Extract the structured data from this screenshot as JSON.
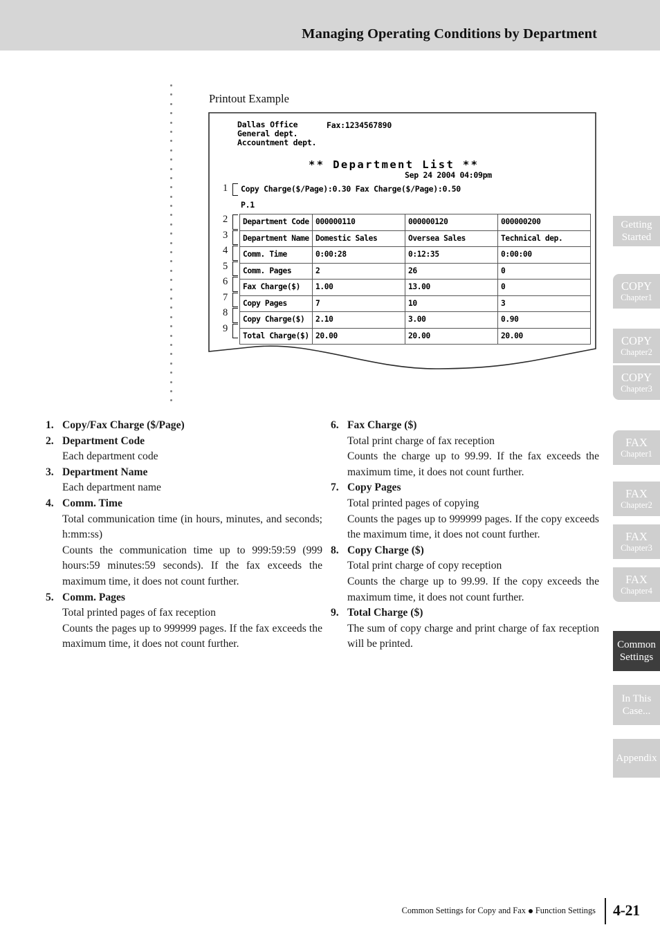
{
  "header": {
    "title": "Managing Operating Conditions by Department"
  },
  "figure": {
    "caption": "Printout Example",
    "printout": {
      "company": "Dallas Office",
      "dept1": "General dept.",
      "dept2": "Accountment dept.",
      "fax": "Fax:1234567890",
      "title": "** Department List **",
      "date": "Sep 24 2004 04:09pm",
      "charge_line": "Copy Charge($/Page):0.30  Fax Charge($/Page):0.50",
      "page_no": "P.1",
      "rows": [
        {
          "marker": "2",
          "label": "Department Code",
          "values": [
            "000000110",
            "000000120",
            "000000200"
          ]
        },
        {
          "marker": "3",
          "label": "Department Name",
          "values": [
            "Domestic Sales",
            "Oversea Sales",
            "Technical dep."
          ]
        },
        {
          "marker": "4",
          "label": "Comm. Time",
          "values": [
            "0:00:28",
            "0:12:35",
            "0:00:00"
          ]
        },
        {
          "marker": "5",
          "label": "Comm. Pages",
          "values": [
            "2",
            "26",
            "0"
          ]
        },
        {
          "marker": "6",
          "label": "Fax Charge($)",
          "values": [
            "1.00",
            "13.00",
            "0"
          ]
        },
        {
          "marker": "7",
          "label": "Copy Pages",
          "values": [
            "7",
            "10",
            "3"
          ]
        },
        {
          "marker": "8",
          "label": "Copy Charge($)",
          "values": [
            "2.10",
            "3.00",
            "0.90"
          ]
        },
        {
          "marker": "9",
          "label": "Total Charge($)",
          "values": [
            "20.00",
            "20.00",
            "20.00"
          ]
        }
      ],
      "charge_marker": "1"
    }
  },
  "legend": {
    "left": [
      {
        "num": "1.",
        "title": "Copy/Fax Charge ($/Page)",
        "lines": []
      },
      {
        "num": "2.",
        "title": "Department Code",
        "lines": [
          "Each department code"
        ]
      },
      {
        "num": "3.",
        "title": "Department Name",
        "lines": [
          "Each department name"
        ]
      },
      {
        "num": "4.",
        "title": "Comm. Time",
        "lines": [
          "Total communication time (in hours, minutes, and seconds; h:mm:ss)",
          "Counts the communication time up to 999:59:59 (999 hours:59 minutes:59 seconds). If the fax exceeds the maximum time, it does not count further."
        ]
      },
      {
        "num": "5.",
        "title": "Comm. Pages",
        "lines": [
          "Total printed pages of fax reception",
          "Counts the pages up to 999999 pages. If the fax exceeds the maximum time, it does not count further."
        ]
      }
    ],
    "right": [
      {
        "num": "6.",
        "title": "Fax Charge ($)",
        "lines": [
          "Total print charge of fax reception",
          "Counts the charge up to 99.99. If the fax exceeds the maximum time, it does not count further."
        ]
      },
      {
        "num": "7.",
        "title": "Copy Pages",
        "lines": [
          "Total printed pages of copying",
          "Counts the pages up to 999999 pages. If the copy exceeds the maximum time, it does not count further."
        ]
      },
      {
        "num": "8.",
        "title": "Copy Charge ($)",
        "lines": [
          "Total print charge of copy reception",
          "Counts the charge up to 99.99. If the copy exceeds the maximum time, it does not count further."
        ]
      },
      {
        "num": "9.",
        "title": "Total Charge ($)",
        "lines": [
          "The sum of copy charge and print charge of fax reception will be printed."
        ]
      }
    ]
  },
  "tabs": [
    {
      "line1": "Getting",
      "line2": "Started",
      "active": false,
      "style": "two-line-plain"
    },
    {
      "line1": "COPY",
      "line2": "Chapter1",
      "active": false,
      "style": "chapter"
    },
    {
      "line1": "COPY",
      "line2": "Chapter2",
      "active": false,
      "style": "chapter"
    },
    {
      "line1": "COPY",
      "line2": "Chapter3",
      "active": false,
      "style": "chapter"
    },
    {
      "line1": "FAX",
      "line2": "Chapter1",
      "active": false,
      "style": "chapter"
    },
    {
      "line1": "FAX",
      "line2": "Chapter2",
      "active": false,
      "style": "chapter"
    },
    {
      "line1": "FAX",
      "line2": "Chapter3",
      "active": false,
      "style": "chapter"
    },
    {
      "line1": "FAX",
      "line2": "Chapter4",
      "active": false,
      "style": "chapter"
    },
    {
      "line1": "Common",
      "line2": "Settings",
      "active": true,
      "style": "two-line-plain"
    },
    {
      "line1": "In This",
      "line2": "Case...",
      "active": false,
      "style": "two-line-plain"
    },
    {
      "line1": "Appendix",
      "line2": "",
      "active": false,
      "style": "single"
    }
  ],
  "footer": {
    "text_before": "Common Settings for Copy and Fax",
    "text_after": "Function Settings",
    "page": "4-21"
  },
  "colors": {
    "header_band": "#d6d6d6",
    "tab_inactive": "#cfcfcf",
    "tab_active": "#3d3d3d",
    "tab_label": "#ffffff",
    "dotted_rule": "#808080",
    "text": "#1a1a1a"
  }
}
